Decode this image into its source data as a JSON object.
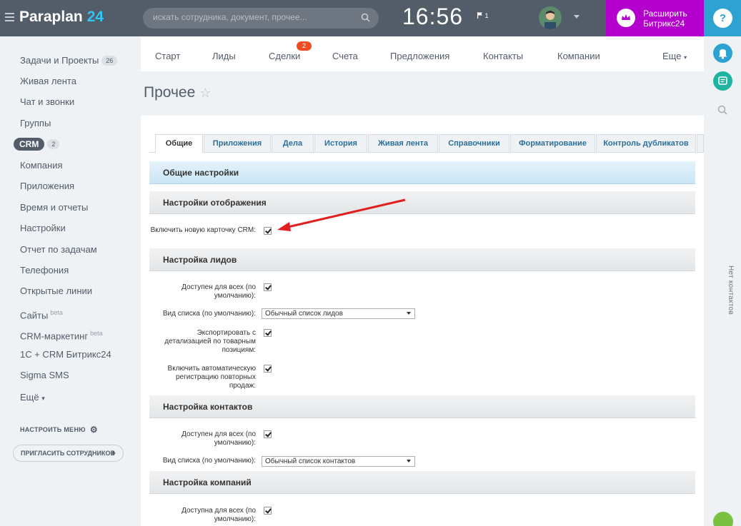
{
  "header": {
    "logo_name": "Paraplan",
    "logo_num": "24",
    "search_placeholder": "искать сотрудника, документ, прочее...",
    "time": "16:56",
    "flag_count": "1",
    "upgrade_line1": "Расширить",
    "upgrade_line2": "Битрикс24",
    "help": "?"
  },
  "sidebar": {
    "items": [
      {
        "label": "Задачи и Проекты",
        "count": "26"
      },
      {
        "label": "Живая лента"
      },
      {
        "label": "Чат и звонки"
      },
      {
        "label": "Группы"
      },
      {
        "label": "CRM",
        "count": "2"
      },
      {
        "label": "Компания"
      },
      {
        "label": "Приложения"
      },
      {
        "label": "Время и отчеты"
      },
      {
        "label": "Настройки"
      },
      {
        "label": "Отчет по задачам"
      },
      {
        "label": "Телефония"
      },
      {
        "label": "Открытые линии"
      },
      {
        "label": "Сайты",
        "sup": "beta"
      },
      {
        "label": "CRM-маркетинг",
        "sup": "beta"
      },
      {
        "label": "1С + CRM Битрикс24"
      },
      {
        "label": "Sigma SMS"
      },
      {
        "label": "Ещё"
      }
    ],
    "configure": "НАСТРОИТЬ МЕНЮ",
    "invite": "ПРИГЛАСИТЬ СОТРУДНИКОВ"
  },
  "topnav": {
    "items": [
      "Старт",
      "Лиды",
      "Сделки",
      "Счета",
      "Предложения",
      "Контакты",
      "Компании",
      "Еще"
    ],
    "deals_badge": "2"
  },
  "page": {
    "title": "Прочее"
  },
  "tabs": [
    "Общие",
    "Приложения",
    "Дела",
    "История",
    "Живая лента",
    "Справочники",
    "Форматирование",
    "Контроль дубликатов"
  ],
  "sections": {
    "general": "Общие настройки",
    "display": "Настройки отображения",
    "leads": "Настройка лидов",
    "contacts": "Настройка контактов",
    "companies": "Настройка компаний"
  },
  "fields": {
    "new_card": {
      "label": "Включить новую карточку CRM:",
      "checked": true
    },
    "leads_available": {
      "label": "Доступен для всех (по умолчанию):",
      "checked": true
    },
    "leads_list_view": {
      "label": "Вид списка (по умолчанию):",
      "value": "Обычный список лидов"
    },
    "export_detail": {
      "label": "Экспортировать с детализацией по товарным позициям:",
      "checked": true
    },
    "auto_repeat": {
      "label": "Включить автоматическую регистрацию повторных продаж:",
      "checked": true
    },
    "contacts_available": {
      "label": "Доступен для всех (по умолчанию):",
      "checked": true
    },
    "contacts_list_view": {
      "label": "Вид списка (по умолчанию):",
      "value": "Обычный список контактов"
    },
    "companies_available": {
      "label": "Доступна для всех (по умолчанию):",
      "checked": true
    }
  },
  "right_panel": {
    "no_contacts": "Нет контактов"
  },
  "colors": {
    "header_bg": "#535c69",
    "brand_blue": "#2fc6f6",
    "upgrade_bg": "#b300cc",
    "badge_red": "#f04b23",
    "arrow_red": "#e02020"
  }
}
